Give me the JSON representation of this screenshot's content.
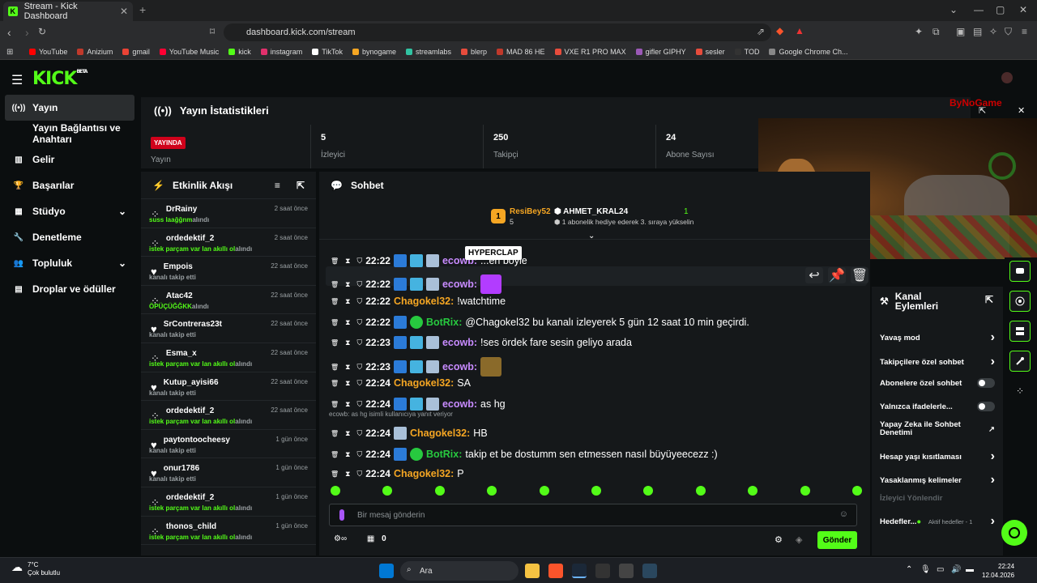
{
  "browser": {
    "tab_title": "Stream - Kick Dashboard",
    "url": "dashboard.kick.com/stream",
    "bookmarks": [
      "YouTube",
      "Anizium",
      "gmail",
      "YouTube Music",
      "kick",
      "instagram",
      "TikTok",
      "bynogame",
      "streamlabs",
      "blerp",
      "MAD 86 HE",
      "VXE R1 PRO MAX",
      "gifler GIPHY",
      "sesler",
      "TOD",
      "Google Chrome Ch..."
    ],
    "bookmark_colors": [
      "#ff0000",
      "#c0392b",
      "#ea4335",
      "#ff0033",
      "#53fc18",
      "#e1306c",
      "#ffffff",
      "#f5a623",
      "#31c3a2",
      "#e74c3c",
      "#c0392b",
      "#e74c3c",
      "#9b59b6",
      "#e74c3c",
      "#333333",
      "#888888"
    ]
  },
  "logo": {
    "text": "KICK",
    "sup": "BETA"
  },
  "sidebar": {
    "items": [
      {
        "label": "Yayın",
        "icon": "broadcast-icon",
        "active": true
      },
      {
        "label": "Yayın Bağlantısı ve Anahtarı",
        "icon": "",
        "active": false
      },
      {
        "label": "Gelir",
        "icon": "chart-icon",
        "active": false
      },
      {
        "label": "Başarılar",
        "icon": "trophy-icon",
        "active": false
      },
      {
        "label": "Stüdyo",
        "icon": "studio-icon",
        "active": false,
        "chevron": true
      },
      {
        "label": "Denetleme",
        "icon": "wrench-icon",
        "active": false
      },
      {
        "label": "Topluluk",
        "icon": "people-icon",
        "active": false,
        "chevron": true
      },
      {
        "label": "Droplar ve ödüller",
        "icon": "gift-icon",
        "active": false
      }
    ]
  },
  "stats": {
    "title": "Yayın İstatistikleri",
    "live_badge": "YAYINDA",
    "live_label": "Yayın",
    "viewers": {
      "value": "5",
      "label": "İzleyici"
    },
    "followers": {
      "value": "250",
      "label": "Takipçi"
    },
    "subs": {
      "value": "24",
      "label": "Abone Sayısı"
    }
  },
  "events": {
    "title": "Etkinlik Akışı",
    "items": [
      {
        "user": "DrRainy",
        "highlight": "suss laağğnm",
        "action": "alındı",
        "time": "2 saat önce",
        "icon": "redeem-icon"
      },
      {
        "user": "ordedektif_2",
        "highlight": "istek parçam var lan akıllı ol",
        "action": "alındı",
        "time": "2 saat önce",
        "icon": "redeem-icon"
      },
      {
        "user": "Empois",
        "highlight": "",
        "action": "kanalı takip etti",
        "time": "22 saat önce",
        "icon": "heart-icon"
      },
      {
        "user": "Atac42",
        "highlight": "ÖPÜÇÜĞĞKK",
        "action": "alındı",
        "time": "22 saat önce",
        "icon": "redeem-icon"
      },
      {
        "user": "SrContreras23t",
        "highlight": "",
        "action": "kanalı takip etti",
        "time": "22 saat önce",
        "icon": "heart-icon"
      },
      {
        "user": "Esma_x",
        "highlight": "istek parçam var lan akıllı ol",
        "action": "alındı",
        "time": "22 saat önce",
        "icon": "redeem-icon"
      },
      {
        "user": "Kutup_ayisi66",
        "highlight": "",
        "action": "kanalı takip etti",
        "time": "22 saat önce",
        "icon": "heart-icon"
      },
      {
        "user": "ordedektif_2",
        "highlight": "istek parçam var lan akıllı ol",
        "action": "alındı",
        "time": "22 saat önce",
        "icon": "redeem-icon"
      },
      {
        "user": "paytontoocheesy",
        "highlight": "",
        "action": "kanalı takip etti",
        "time": "1 gün önce",
        "icon": "heart-icon"
      },
      {
        "user": "onur1786",
        "highlight": "",
        "action": "kanalı takip etti",
        "time": "1 gün önce",
        "icon": "heart-icon"
      },
      {
        "user": "ordedektif_2",
        "highlight": "istek parçam var lan akıllı ol",
        "action": "alındı",
        "time": "1 gün önce",
        "icon": "redeem-icon"
      },
      {
        "user": "thonos_child",
        "highlight": "istek parçam var lan akıllı ol",
        "action": "alındı",
        "time": "1 gün önce",
        "icon": "redeem-icon"
      }
    ]
  },
  "chat": {
    "title": "Sohbet",
    "pinned": {
      "rank": "1",
      "top_user": "ResiBey52",
      "top_count": "5",
      "gifter": "AHMET_KRAL24",
      "gift_count": "1",
      "gift_text": "1 abonelik hediye ederek 3. sıraya yükselin"
    },
    "tooltip": "HYPERCLAP",
    "messages": [
      {
        "time": "22:22",
        "user": "ecowb",
        "color": "#c88bff",
        "text": "...en böyle",
        "badges": 3
      },
      {
        "time": "22:22",
        "user": "ecowb",
        "color": "#c88bff",
        "text": "",
        "badges": 3,
        "emote": "#b23cff"
      },
      {
        "time": "22:22",
        "user": "Chagokel32",
        "color": "#f5a623",
        "text": "!watchtime",
        "badges": 0
      },
      {
        "time": "22:22",
        "user": "BotRix",
        "color": "#27c93f",
        "text": "@Chagokel32 bu kanalı izleyerek 5 gün 12 saat 10 min geçirdi.",
        "badges": 2
      },
      {
        "time": "22:23",
        "user": "ecowb",
        "color": "#c88bff",
        "text": "!ses ördek fare sesin geliyo arada",
        "badges": 3
      },
      {
        "time": "22:23",
        "user": "ecowb",
        "color": "#c88bff",
        "text": "",
        "badges": 3,
        "emote": "#8a6a2a"
      },
      {
        "time": "22:24",
        "user": "Chagokel32",
        "color": "#f5a623",
        "text": "SA",
        "badges": 0
      },
      {
        "time": "22:24",
        "user": "ecowb",
        "color": "#c88bff",
        "text": "as hg",
        "badges": 3
      },
      {
        "time": "22:24",
        "user": "Chagokel32",
        "color": "#f5a623",
        "text": "HB",
        "badges": 1,
        "reply": "ecowb: as hg isimli kullanıcıya yanıt veriyor"
      },
      {
        "time": "22:24",
        "user": "BotRix",
        "color": "#27c93f",
        "text": "takip et be dostumm sen etmessen nasıl büyüyeecezz :)",
        "badges": 2
      },
      {
        "time": "22:24",
        "user": "Chagokel32",
        "color": "#f5a623",
        "text": "P",
        "badges": 0
      }
    ],
    "input_placeholder": "Bir mesaj gönderin",
    "points": "0",
    "send_label": "Gönder"
  },
  "channel_actions": {
    "title_line1": "Kanal",
    "title_line2": "Eylemleri",
    "items": [
      {
        "label": "Yavaş mod",
        "control": "chevron"
      },
      {
        "label": "Takipçilere özel sohbet",
        "control": "chevron"
      },
      {
        "label": "Abonelere özel sohbet",
        "control": "toggle"
      },
      {
        "label": "Yalnızca ifadelerle...",
        "control": "toggle"
      },
      {
        "label": "Yapay Zeka ile Sohbet Denetimi",
        "control": "external"
      },
      {
        "label": "Hesap yaşı kısıtlaması",
        "control": "chevron"
      },
      {
        "label": "Yasaklanmış kelimeler",
        "control": "chevron"
      },
      {
        "label": "İzleyici Yönlendir",
        "control": "none"
      },
      {
        "label": "Hedefler...",
        "control": "chevron",
        "sub": "Aktif hedefler - 1"
      }
    ]
  },
  "video": {
    "watermark": "ByNoGame"
  },
  "taskbar": {
    "temp": "7°C",
    "weather": "Çok bulutlu",
    "search": "Ara",
    "time": "22:24",
    "date": "12.04.2026"
  }
}
